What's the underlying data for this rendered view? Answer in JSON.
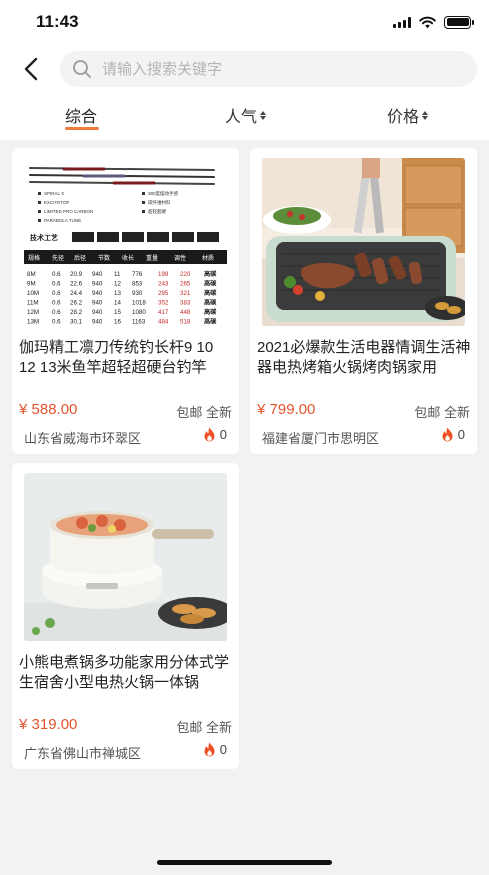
{
  "status_bar": {
    "time": "11:43"
  },
  "search": {
    "placeholder": "请输入搜索关键字"
  },
  "sort_tabs": [
    {
      "label": "综合",
      "active": true
    },
    {
      "label": "人气",
      "active": false
    },
    {
      "label": "价格",
      "active": false
    }
  ],
  "accent_color": "#f07b3f",
  "price_color": "#e2552c",
  "products": [
    {
      "title": "伽玛精工凛刀传统钓长杆9 10 12 13米鱼竿超轻超硬台钓竿",
      "price": "¥ 588.00",
      "tags": "包邮 全新",
      "location": "山东省威海市环翠区",
      "heat": "0",
      "image": {
        "features": [
          "SPIRAL X",
          "EXCITETOP",
          "LIMITED PRO CARBON",
          "PARABOLA TUNE",
          "380度摆动手感",
          "碳纤维材料",
          "超轻超硬"
        ],
        "spec_label": "技术工艺",
        "spec_headers": [
          "规格",
          "先径",
          "后径",
          "节数",
          "收长",
          "重量",
          "调性",
          "材质"
        ],
        "spec_rows": [
          [
            "8M",
            "0.6",
            "20.9",
            "940",
            "11",
            "776",
            "199",
            "220",
            "高碳"
          ],
          [
            "9M",
            "0.6",
            "22.6",
            "940",
            "12",
            "853",
            "243",
            "265",
            "高碳"
          ],
          [
            "10M",
            "0.6",
            "24.4",
            "940",
            "13",
            "930",
            "295",
            "321",
            "高碳"
          ],
          [
            "11M",
            "0.6",
            "26.2",
            "940",
            "14",
            "1018",
            "352",
            "383",
            "高碳"
          ],
          [
            "12M",
            "0.6",
            "28.2",
            "940",
            "15",
            "1080",
            "417",
            "448",
            "高碳"
          ],
          [
            "13M",
            "0.6",
            "30.1",
            "940",
            "16",
            "1163",
            "484",
            "518",
            "高碳"
          ]
        ]
      }
    },
    {
      "title": "2021必爆款生活电器情调生活神器电热烤箱火锅烤肉锅家用",
      "price": "¥ 799.00",
      "tags": "包邮 全新",
      "location": "福建省厦门市思明区",
      "heat": "0",
      "image": {
        "depicts": "electric grill plate with sliced meat"
      }
    },
    {
      "title": "小熊电煮锅多功能家用分体式学生宿舍小型电热火锅一体锅",
      "price": "¥ 319.00",
      "tags": "包邮 全新",
      "location": "广东省佛山市禅城区",
      "heat": "0",
      "image": {
        "depicts": "white electric cooking pot with noodles"
      }
    }
  ]
}
